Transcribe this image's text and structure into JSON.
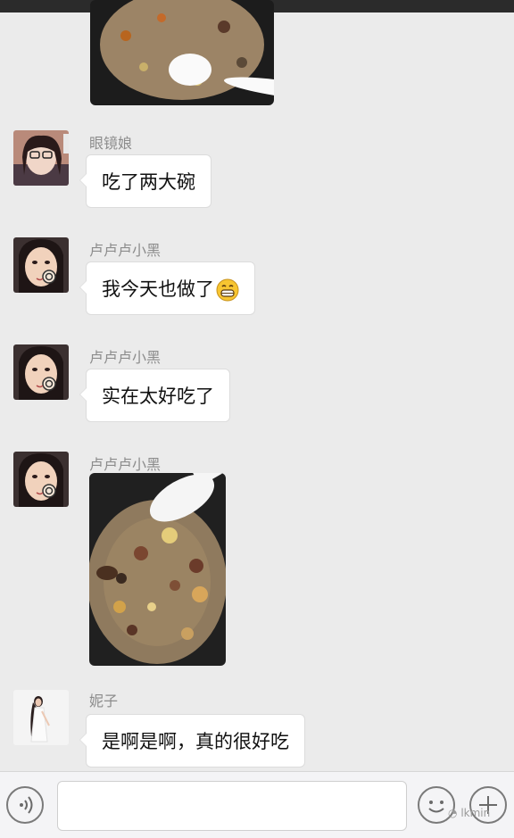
{
  "messages": [
    {
      "sender": "眼镜娘",
      "text": "吃了两大碗"
    },
    {
      "sender": "卢卢卢小黑",
      "text": "我今天也做了"
    },
    {
      "sender": "卢卢卢小黑",
      "text": "实在太好吃了"
    },
    {
      "sender": "卢卢卢小黑"
    },
    {
      "sender": "妮子",
      "text": "是啊是啊，真的很好吃"
    }
  ],
  "input": {
    "placeholder": ""
  },
  "watermark": "lkmin",
  "colors": {
    "background": "#ebebeb",
    "bubble": "#ffffff",
    "sender_name": "#8c8c8c"
  }
}
